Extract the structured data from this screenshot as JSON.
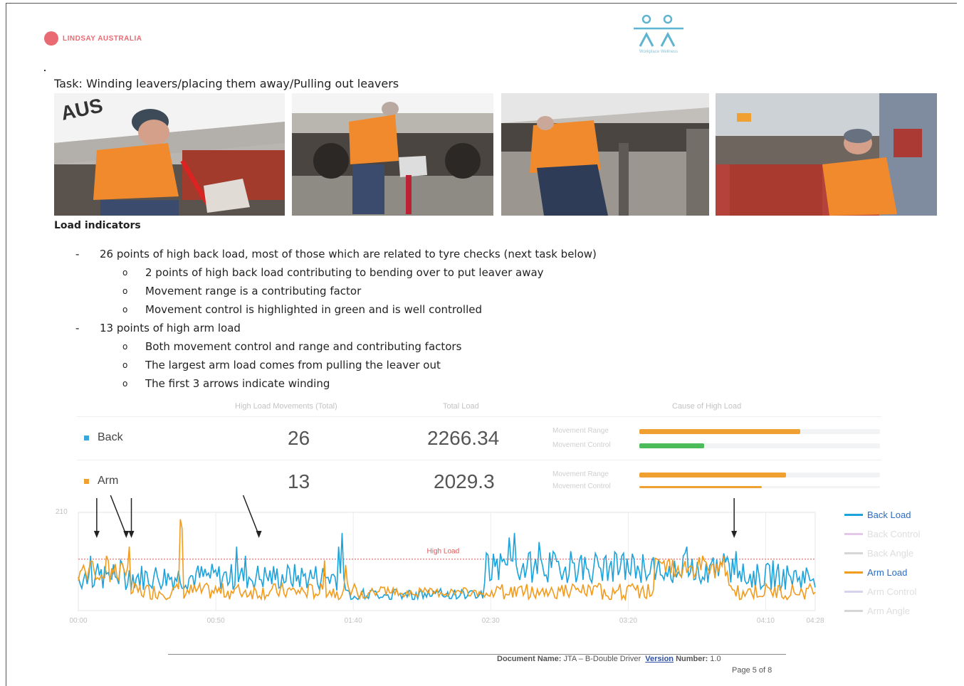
{
  "header": {
    "left_logo_text": "LINDSAY AUSTRALIA",
    "right_logo_text": "Workplace Wellness"
  },
  "task_title": "Task: Winding leavers/placing them away/Pulling out leavers",
  "section_title": "Load indicators",
  "bullets": [
    {
      "mark": "-",
      "text": "26 points of high back load, most of those which are related to tyre checks (next task below)"
    },
    {
      "mark": "o",
      "text": "2 points of high back load contributing to bending over to put leaver away"
    },
    {
      "mark": "o",
      "text": "Movement range is a contributing factor"
    },
    {
      "mark": "o",
      "text": "Movement control is highlighted in green and is well controlled"
    },
    {
      "mark": "-",
      "text": "13 points of high arm load"
    },
    {
      "mark": "o",
      "text": "Both movement control and range and contributing factors"
    },
    {
      "mark": "o",
      "text": "The largest arm load comes from pulling the leaver out"
    },
    {
      "mark": "o",
      "text": "The first 3 arrows indicate winding"
    }
  ],
  "summary_table": {
    "headers": [
      "High Load Movements (Total)",
      "Total Load",
      "Cause of High Load"
    ],
    "rows": [
      {
        "label": "Back",
        "color": "#3aa6dd",
        "movements": "26",
        "total": "2266.34",
        "causes": [
          {
            "label": "Movement Range",
            "fraction": 0.67,
            "color": "#f0a030"
          },
          {
            "label": "Movement Control",
            "fraction": 0.27,
            "color": "#4cbb5a"
          }
        ]
      },
      {
        "label": "Arm",
        "color": "#f0a030",
        "movements": "13",
        "total": "2029.3",
        "causes": [
          {
            "label": "Movement Range",
            "fraction": 0.61,
            "color": "#f0a030"
          },
          {
            "label": "Movement Control",
            "fraction": 0.51,
            "color": "#f0a030"
          }
        ]
      }
    ]
  },
  "chart_data": {
    "type": "line",
    "y_axis_label": "210",
    "threshold_label": "High Load",
    "x_ticks": [
      "00:00",
      "00:50",
      "01:40",
      "02:30",
      "03:20",
      "04:10",
      "04:28"
    ],
    "legend": [
      {
        "name": "Back Load",
        "color": "#1aa3dc",
        "dim": false
      },
      {
        "name": "Back Control",
        "color": "#e4c8e8",
        "dim": true
      },
      {
        "name": "Back Angle",
        "color": "#d6d6d6",
        "dim": true
      },
      {
        "name": "Arm Load",
        "color": "#f29b1d",
        "dim": false
      },
      {
        "name": "Arm Control",
        "color": "#d8d3ec",
        "dim": true
      },
      {
        "name": "Arm Angle",
        "color": "#d6d6d6",
        "dim": true
      }
    ],
    "ymax": 210,
    "threshold": 110,
    "arrows_at_fraction": [
      0.025,
      0.065,
      0.072,
      0.245,
      0.89
    ]
  },
  "footer": {
    "doc_name_label": "Document Name:",
    "doc_name": "JTA – B-Double Driver",
    "version_label": "Version",
    "number_label": "Number:",
    "number": "1.0",
    "page": "Page 5 of 8"
  }
}
